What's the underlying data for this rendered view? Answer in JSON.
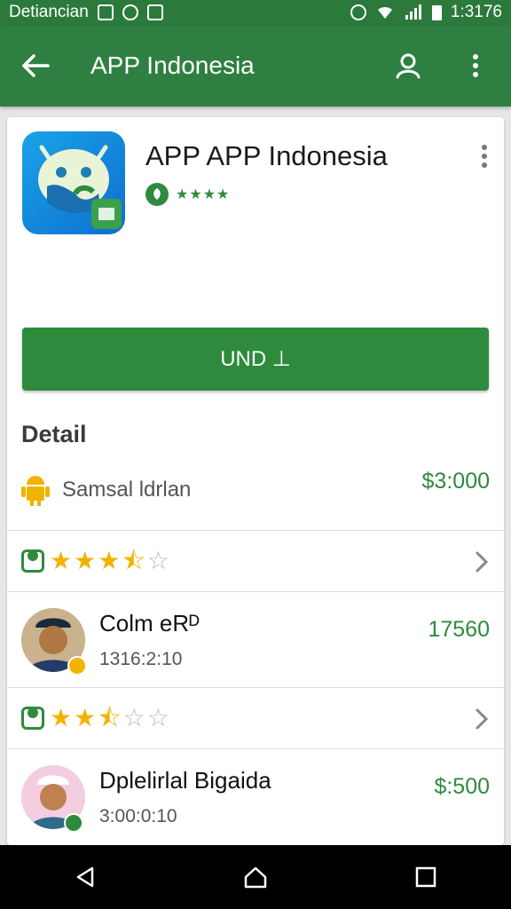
{
  "status_bar": {
    "carrier": "Detiancian",
    "time": "1:3176"
  },
  "app_bar": {
    "title": "APP Indonesia",
    "back_icon": "back-arrow-icon",
    "account_icon": "account-icon",
    "menu_icon": "more-vert-icon"
  },
  "app": {
    "name": "APP APP Indonesia",
    "badge_stars": "★★★★",
    "install_label": "UND ⊥"
  },
  "detail": {
    "heading": "Detail",
    "developer": "Samsal ldrlan",
    "developer_value": "$3:000"
  },
  "ratings": [
    {
      "stars": 3.5
    },
    {
      "stars": 2.5
    }
  ],
  "reviews": [
    {
      "name": "Colm eRᴰ",
      "time": "1316:2:10",
      "value": "17560"
    },
    {
      "name": "Dplelirlal Bigaida",
      "time": "3:00:0:10",
      "value": "$:500"
    }
  ],
  "colors": {
    "primary": "#2f7f43",
    "status_bar": "#2b7a3c",
    "accent": "#2e8b3d",
    "star": "#f2b300"
  }
}
